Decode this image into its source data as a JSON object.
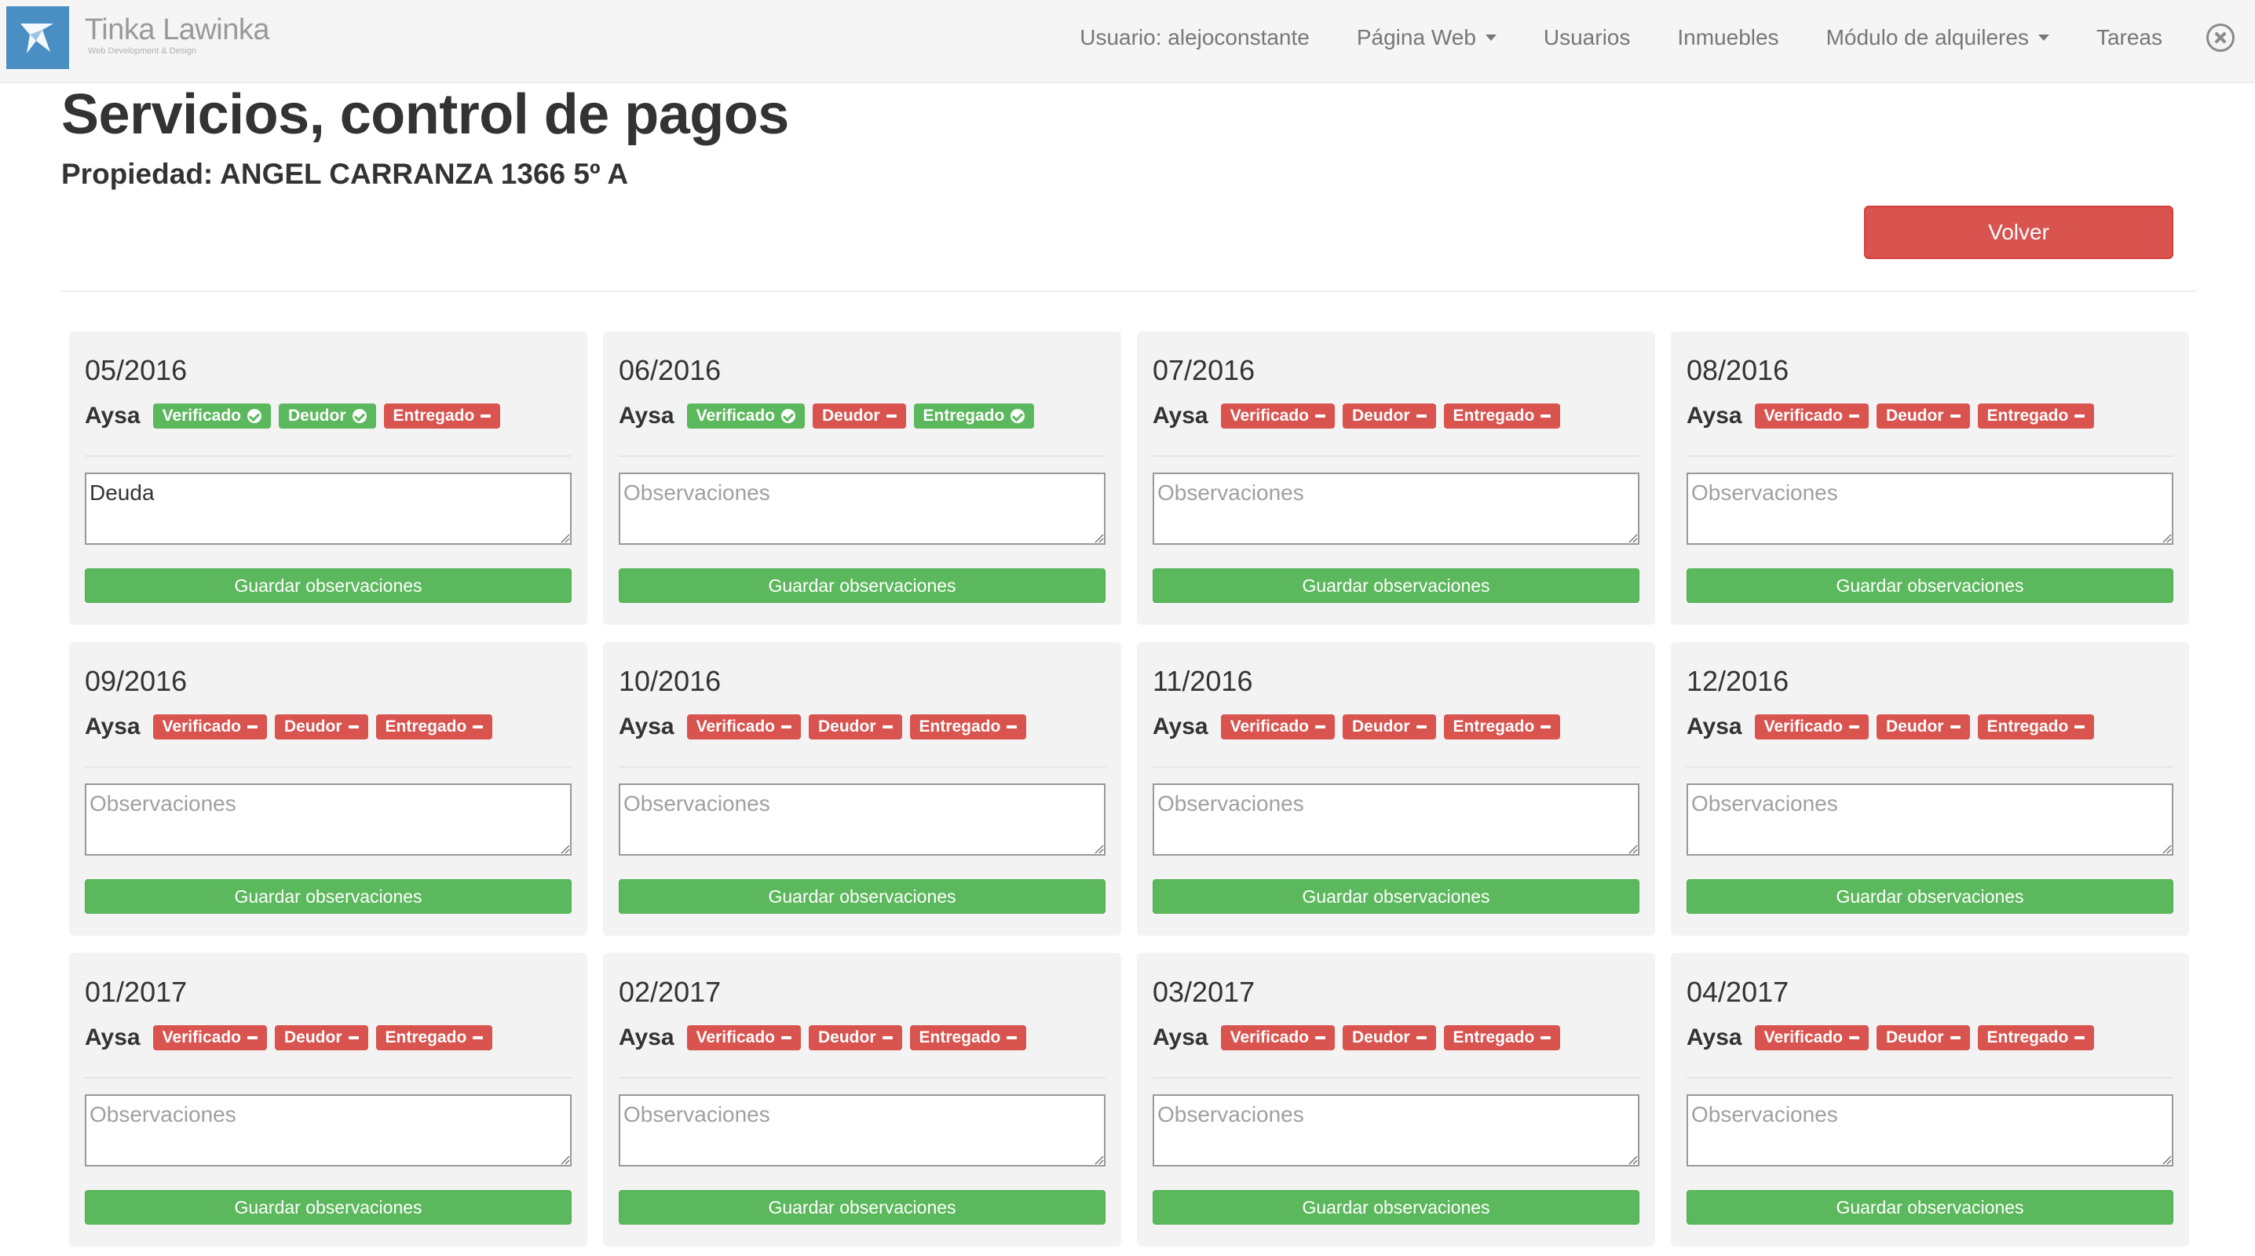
{
  "brand": {
    "name": "Tinka Lawinka",
    "tagline": "Web Development & Design"
  },
  "nav": {
    "user": "Usuario: alejoconstante",
    "items": [
      {
        "label": "Página Web",
        "dropdown": true
      },
      {
        "label": "Usuarios",
        "dropdown": false
      },
      {
        "label": "Inmuebles",
        "dropdown": false
      },
      {
        "label": "Módulo de alquileres",
        "dropdown": true
      },
      {
        "label": "Tareas",
        "dropdown": false
      }
    ]
  },
  "page": {
    "title": "Servicios, control de pagos",
    "property": "Propiedad: ANGEL CARRANZA 1366 5º A",
    "back_label": "Volver"
  },
  "colors": {
    "success": "#5cb85c",
    "danger": "#d9534f"
  },
  "labels": {
    "service": "Aysa",
    "verificado": "Verificado",
    "deudor": "Deudor",
    "entregado": "Entregado",
    "placeholder": "Observaciones",
    "save": "Guardar observaciones"
  },
  "periods": [
    {
      "month": "05/2016",
      "verificado": true,
      "deudor": true,
      "entregado": false,
      "observaciones": "Deuda"
    },
    {
      "month": "06/2016",
      "verificado": true,
      "deudor": false,
      "entregado": true,
      "observaciones": ""
    },
    {
      "month": "07/2016",
      "verificado": false,
      "deudor": false,
      "entregado": false,
      "observaciones": ""
    },
    {
      "month": "08/2016",
      "verificado": false,
      "deudor": false,
      "entregado": false,
      "observaciones": ""
    },
    {
      "month": "09/2016",
      "verificado": false,
      "deudor": false,
      "entregado": false,
      "observaciones": ""
    },
    {
      "month": "10/2016",
      "verificado": false,
      "deudor": false,
      "entregado": false,
      "observaciones": ""
    },
    {
      "month": "11/2016",
      "verificado": false,
      "deudor": false,
      "entregado": false,
      "observaciones": ""
    },
    {
      "month": "12/2016",
      "verificado": false,
      "deudor": false,
      "entregado": false,
      "observaciones": ""
    },
    {
      "month": "01/2017",
      "verificado": false,
      "deudor": false,
      "entregado": false,
      "observaciones": ""
    },
    {
      "month": "02/2017",
      "verificado": false,
      "deudor": false,
      "entregado": false,
      "observaciones": ""
    },
    {
      "month": "03/2017",
      "verificado": false,
      "deudor": false,
      "entregado": false,
      "observaciones": ""
    },
    {
      "month": "04/2017",
      "verificado": false,
      "deudor": false,
      "entregado": false,
      "observaciones": ""
    }
  ]
}
